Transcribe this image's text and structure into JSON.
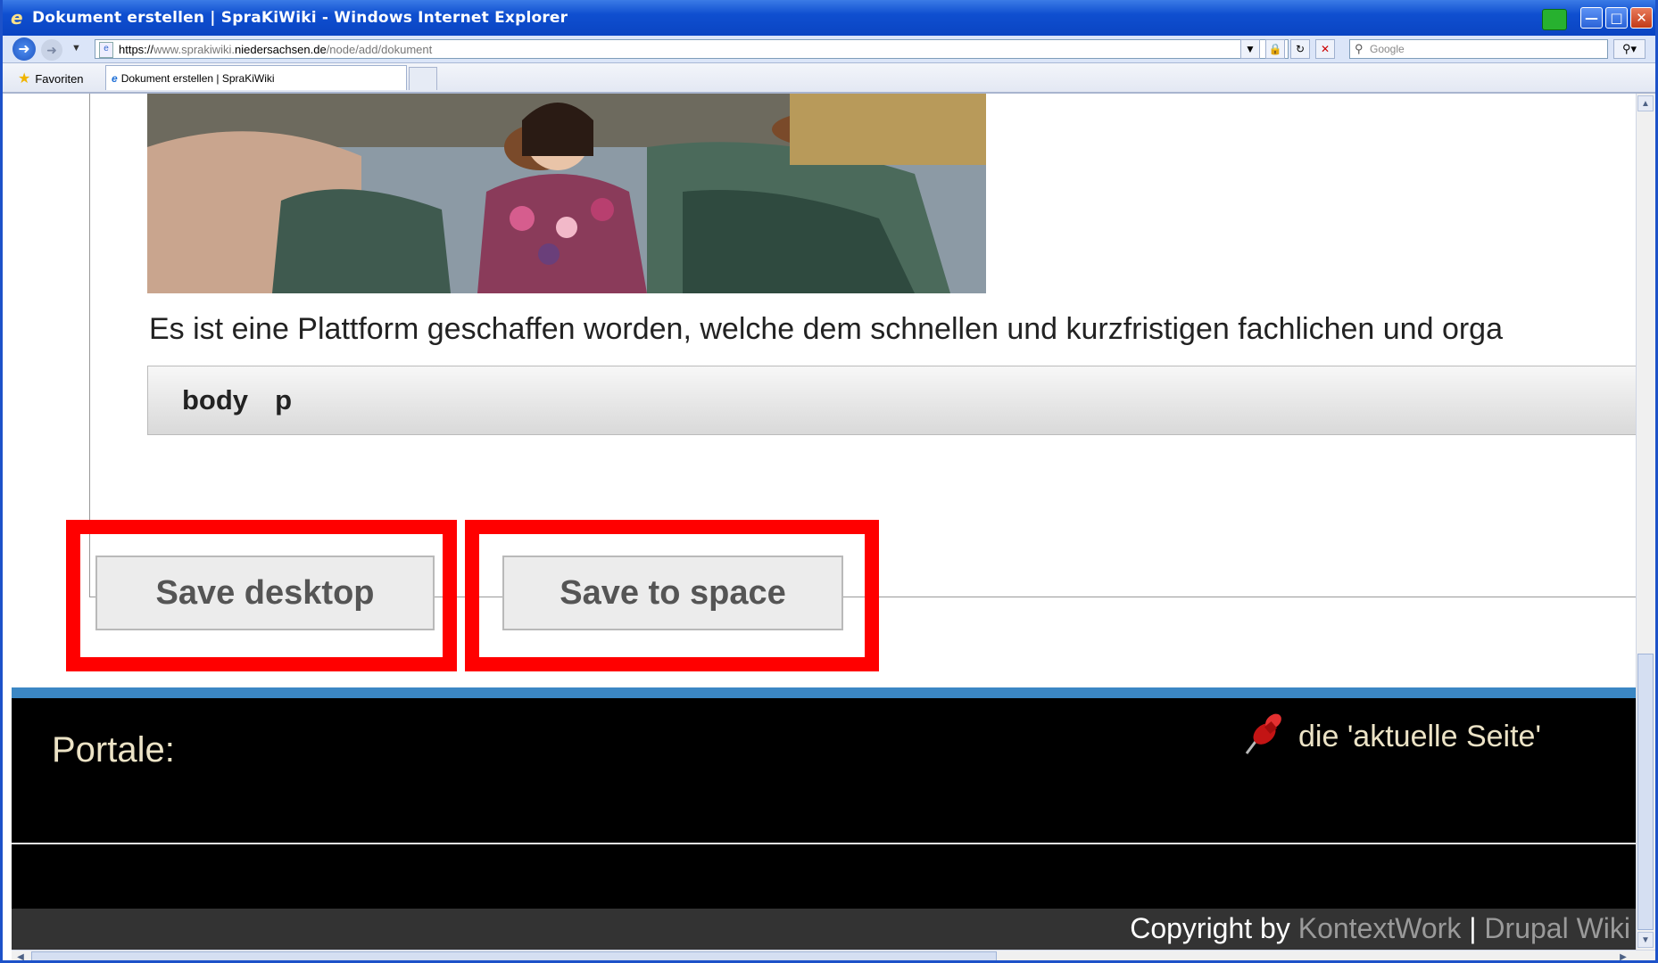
{
  "window": {
    "title": "Dokument erstellen | SpraKiWiki - Windows Internet Explorer"
  },
  "address_bar": {
    "scheme": "https://",
    "host_dim": "www.sprakiwiki.",
    "host": "niedersachsen.de",
    "path": "/node/add/dokument"
  },
  "search": {
    "placeholder": "Google"
  },
  "favorites_label": "Favoriten",
  "tab": {
    "title": "Dokument erstellen | SpraKiWiki"
  },
  "editor": {
    "paragraph": "Es ist eine Plattform geschaffen worden, welche dem schnellen und kurzfristigen fachlichen und orga",
    "path_items": [
      "body",
      "p"
    ]
  },
  "buttons": {
    "save_desktop": "Save desktop",
    "save_to_space": "Save to space"
  },
  "highlight_color": "#ff0000",
  "footer": {
    "portale_label": "Portale:",
    "current_page": "die 'aktuelle Seite'",
    "copyright_prefix": "Copyright by",
    "link_kontextwork": "KontextWork",
    "separator": "|",
    "link_drupal": "Drupal Wiki"
  }
}
